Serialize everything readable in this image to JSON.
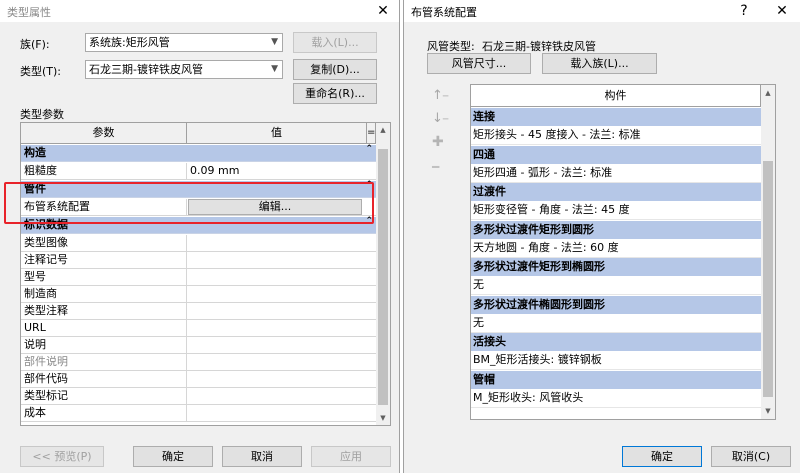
{
  "left_dialog": {
    "title": "类型属性",
    "close_glyph": "✕",
    "family_label": "族(F):",
    "family_value": "系统族:矩形风管",
    "load_button": "载入(L)...",
    "type_label": "类型(T):",
    "type_value": "石龙三期-镀锌铁皮风管",
    "copy_button": "复制(D)...",
    "rename_button": "重命名(R)...",
    "type_params_label": "类型参数",
    "grid": {
      "col_param": "参数",
      "col_value": "值",
      "col_eq": "=",
      "sections": {
        "construction": "构造",
        "fittings": "管件",
        "identity": "标识数据"
      },
      "roughness_label": "粗糙度",
      "roughness_value": "0.09 mm",
      "routing_label": "布管系统配置",
      "edit_button": "编辑...",
      "identity_rows": [
        "类型图像",
        "注释记号",
        "型号",
        "制造商",
        "类型注释",
        "URL",
        "说明",
        "部件说明",
        "部件代码",
        "类型标记",
        "成本"
      ]
    },
    "preview_button": "<< 预览(P)",
    "ok_button": "确定",
    "cancel_button": "取消",
    "apply_button": "应用"
  },
  "right_dialog": {
    "title": "布管系统配置",
    "help_glyph": "?",
    "close_glyph": "✕",
    "duct_type_label": "风管类型:",
    "duct_type_value": "石龙三期-镀锌铁皮风管",
    "duct_sizes_button": "风管尺寸...",
    "load_family_button": "载入族(L)...",
    "list_header": "构件",
    "move_up_glyph": "↑",
    "move_down_glyph": "↓",
    "add_glyph": "✚",
    "remove_glyph": "━",
    "sections": [
      {
        "header": "连接",
        "item": "矩形接头 - 45 度接入 - 法兰: 标准"
      },
      {
        "header": "四通",
        "item": "矩形四通 - 弧形 - 法兰: 标准"
      },
      {
        "header": "过渡件",
        "item": "矩形变径管 - 角度 - 法兰: 45 度"
      },
      {
        "header": "多形状过渡件矩形到圆形",
        "item": "天方地圆 - 角度 - 法兰: 60 度"
      },
      {
        "header": "多形状过渡件矩形到椭圆形",
        "item": "无"
      },
      {
        "header": "多形状过渡件椭圆形到圆形",
        "item": "无"
      },
      {
        "header": "活接头",
        "item": "BM_矩形活接头: 镀锌钢板"
      },
      {
        "header": "管帽",
        "item": "M_矩形收头: 风管收头"
      }
    ],
    "ok_button": "确定",
    "cancel_button": "取消(C)"
  },
  "colors": {
    "section_header": "#b5c7e7",
    "highlight_box": "#e8232a",
    "default_button_border": "#0078d7"
  }
}
